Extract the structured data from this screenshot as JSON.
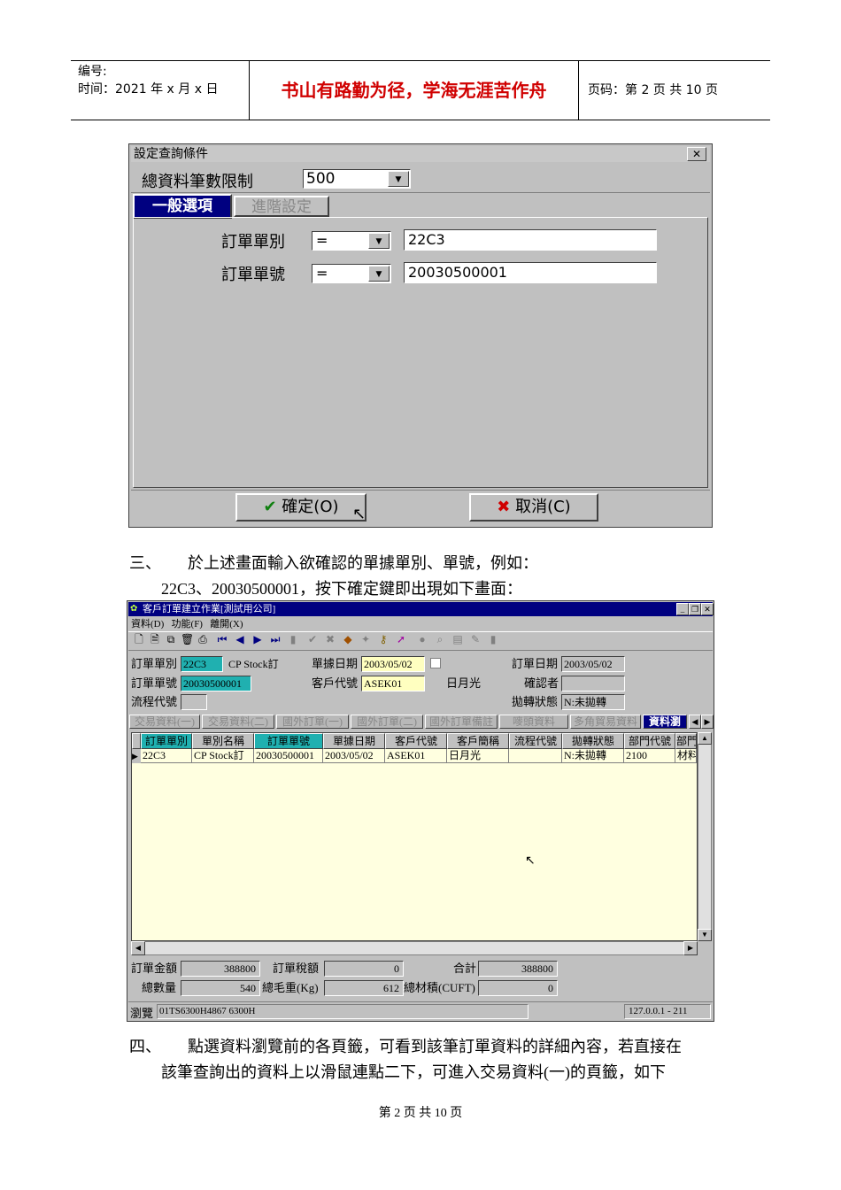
{
  "header": {
    "number_label": "编号:",
    "time_label": "时间：2021 年 x 月 x 日",
    "motto": "书山有路勤为径，学海无涯苦作舟",
    "page_label": "页码：第 2 页  共 10 页"
  },
  "dialog": {
    "title": "設定查詢條件",
    "close": "✕",
    "limit_label": "總資料筆數限制",
    "limit_value": "500",
    "tabs": [
      "一般選項",
      "進階設定"
    ],
    "rows": [
      {
        "label": "訂單單別",
        "op": "=",
        "value": "22C3"
      },
      {
        "label": "訂單單號",
        "op": "=",
        "value": "20030500001"
      }
    ],
    "ok_label": "確定(O)",
    "cancel_label": "取消(C)"
  },
  "para1": {
    "num": "三、",
    "line1": "於上述畫面輸入欲確認的單據單別、單號，例如：",
    "line2": "22C3、20030500001，按下確定鍵即出現如下畫面："
  },
  "window": {
    "title": "客戶訂單建立作業[測試用公司]",
    "menu": [
      "資料(D)",
      "功能(F)",
      "離開(X)"
    ],
    "form": {
      "order_type_label": "訂單單別",
      "order_type": "22C3",
      "order_type_name": "CP Stock訂",
      "doc_date_label": "單據日期",
      "doc_date": "2003/05/02",
      "order_date_label": "訂單日期",
      "order_date": "2003/05/02",
      "order_no_label": "訂單單號",
      "order_no": "20030500001",
      "customer_label": "客戶代號",
      "customer": "ASEK01",
      "customer_name": "日月光",
      "confirmer_label": "確認者",
      "flow_label": "流程代號",
      "transfer_label": "拋轉狀態",
      "transfer": "N:未拋轉"
    },
    "tabs": [
      "交易資料(一)",
      "交易資料(二)",
      "國外訂單(一)",
      "國外訂單(二)",
      "國外訂單備註",
      "嘜頭資料",
      "多角貿易資料",
      "資料瀏"
    ],
    "grid_headers": [
      "訂單單別",
      "單別名稱",
      "訂單單號",
      "單據日期",
      "客戶代號",
      "客戶簡稱",
      "流程代號",
      "拋轉狀態",
      "部門代號",
      "部門"
    ],
    "grid_row": [
      "22C3",
      "CP Stock訂",
      "20030500001",
      "2003/05/02",
      "ASEK01",
      "日月光",
      "",
      "N:未拋轉",
      "2100",
      "材料"
    ],
    "totals": {
      "amount_label": "訂單金額",
      "amount": "388800",
      "tax_label": "訂單稅額",
      "tax": "0",
      "sum_label": "合計",
      "sum": "388800",
      "qty_label": "總數量",
      "qty": "540",
      "weight_label": "總毛重(Kg)",
      "weight": "612",
      "volume_label": "總材積(CUFT)",
      "volume": "0"
    },
    "status": {
      "mode": "瀏覽",
      "code": "01TS6300H4867 6300H",
      "ip": "127.0.0.1 - 211"
    }
  },
  "para2": {
    "num": "四、",
    "line1": "點選資料瀏覽前的各頁籤，可看到該筆訂單資料的詳細內容，若直接在",
    "line2": "該筆查詢出的資料上以滑鼠連點二下，可進入交易資料(一)的頁籤，如下"
  },
  "footer": "第  2  页  共  10  页"
}
